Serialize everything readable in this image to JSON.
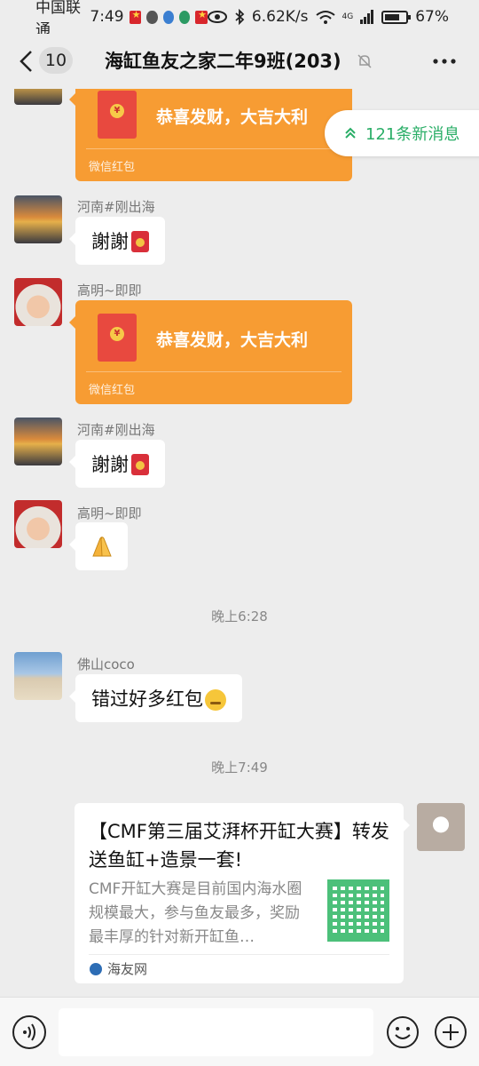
{
  "status_bar": {
    "carrier": "中国联通",
    "time": "7:49",
    "net_speed": "6.62K/s",
    "network_type": "4G",
    "battery": "67%"
  },
  "header": {
    "unread_count": "10",
    "title": "海缸鱼友之家二年9班(203)",
    "icons": [
      "back-icon",
      "mute-icon",
      "more-icon"
    ]
  },
  "new_messages": {
    "label": "121条新消息"
  },
  "messages": [
    {
      "type": "red_packet",
      "text": "恭喜发财，大吉大利",
      "label": "微信红包"
    },
    {
      "type": "text",
      "sender": "河南#刚出海",
      "text": "謝謝"
    },
    {
      "type": "red_packet",
      "sender": "高明~即即",
      "text": "恭喜发财，大吉大利",
      "label": "微信红包"
    },
    {
      "type": "text",
      "sender": "河南#刚出海",
      "text": "謝謝"
    },
    {
      "type": "emoji",
      "sender": "高明~即即",
      "emoji": "pray"
    },
    {
      "type": "time",
      "text": "晚上6:28"
    },
    {
      "type": "text",
      "sender": "佛山coco",
      "text": "错过好多红包"
    },
    {
      "type": "time",
      "text": "晚上7:49"
    },
    {
      "type": "link",
      "title": "【CMF第三届艾湃杯开缸大赛】转发送鱼缸+造景一套!",
      "description": "CMF开缸大赛是目前国内海水圈规模最大，参与鱼友最多，奖励最丰厚的针对新开缸鱼…",
      "source": "海友网"
    }
  ],
  "input_bar": {
    "placeholder": "",
    "icons": [
      "voice-icon",
      "emoji-icon",
      "plus-icon"
    ]
  },
  "colors": {
    "background": "#ededed",
    "red_packet": "#f79c33",
    "accent_green": "#2aae67"
  }
}
